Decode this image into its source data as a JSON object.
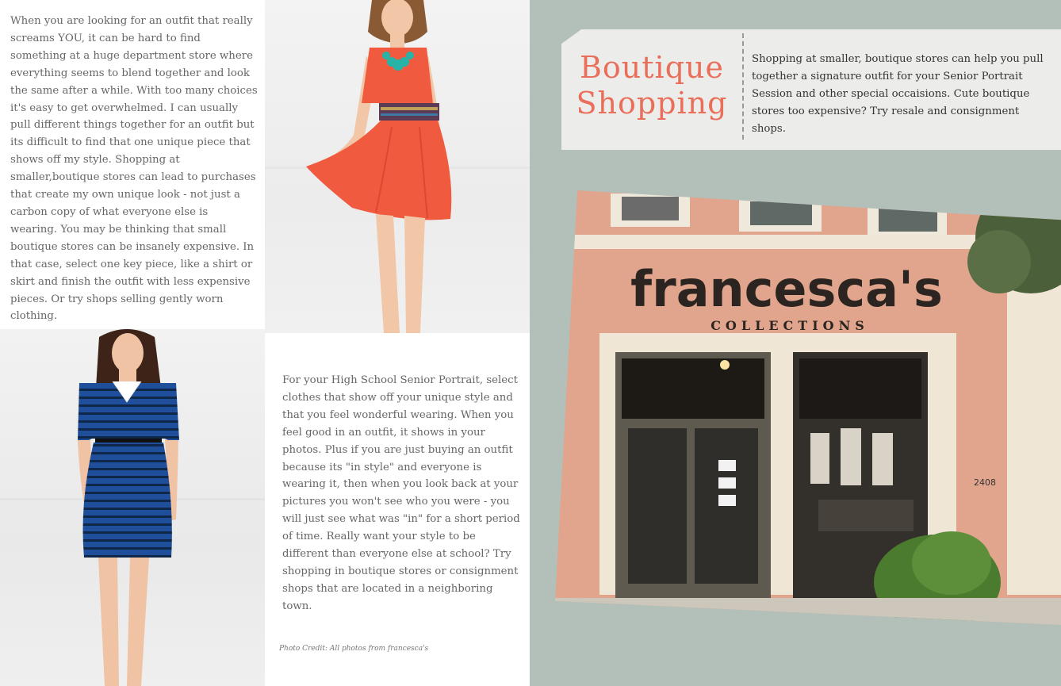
{
  "intro": {
    "text": "When you are looking for an outfit that really screams YOU, it can be hard to find something at a huge department store where everything seems to blend together and look the same after a while. With too many choices it's easy to get overwhelmed.  I can usually pull different things together for an outfit but its difficult to find that one unique piece that shows off my style.  Shopping at smaller,boutique stores can lead to purchases that create my own unique look - not just a carbon copy of what everyone else is wearing.  You may be thinking that small boutique stores can be insanely expensive.  In that case, select one key piece, like a shirt or skirt and finish the outfit with less expensive pieces.  Or try shops selling gently worn clothing."
  },
  "senior": {
    "text": "For your High School Senior Portrait, select clothes that show off your unique style and that you feel wonderful wearing.  When you feel good in an outfit, it shows in your photos.  Plus if you are just buying an outfit because its \"in style\" and everyone is wearing it, then when you look back at your pictures you won't see who you were - you will just see what was \"in\" for a short period of time.  Really want your style to be different than everyone else at school?  Try shopping in boutique stores or consignment shops that are located in a neighboring town."
  },
  "credit": "Photo Credit:  All photos from francesca's",
  "banner": {
    "title_line1": "Boutique",
    "title_line2": "Shopping",
    "text": "Shopping at smaller, boutique stores can help you pull together a signature outfit for your Senior Portrait Session and other special occaisions.  Cute boutique stores too expensive?  Try resale and consignment shops."
  },
  "store": {
    "sign_main": "francesca's",
    "sign_sub": "COLLECTIONS",
    "address": "2408"
  },
  "colors": {
    "accent": "#ea6f5a",
    "panel": "#b3c0ba",
    "banner": "#ececea",
    "red_dress": "#f05a3e",
    "blue_dress": "#1f4f9a",
    "turquoise": "#27b3a7",
    "storefront": "#e0a58c"
  }
}
